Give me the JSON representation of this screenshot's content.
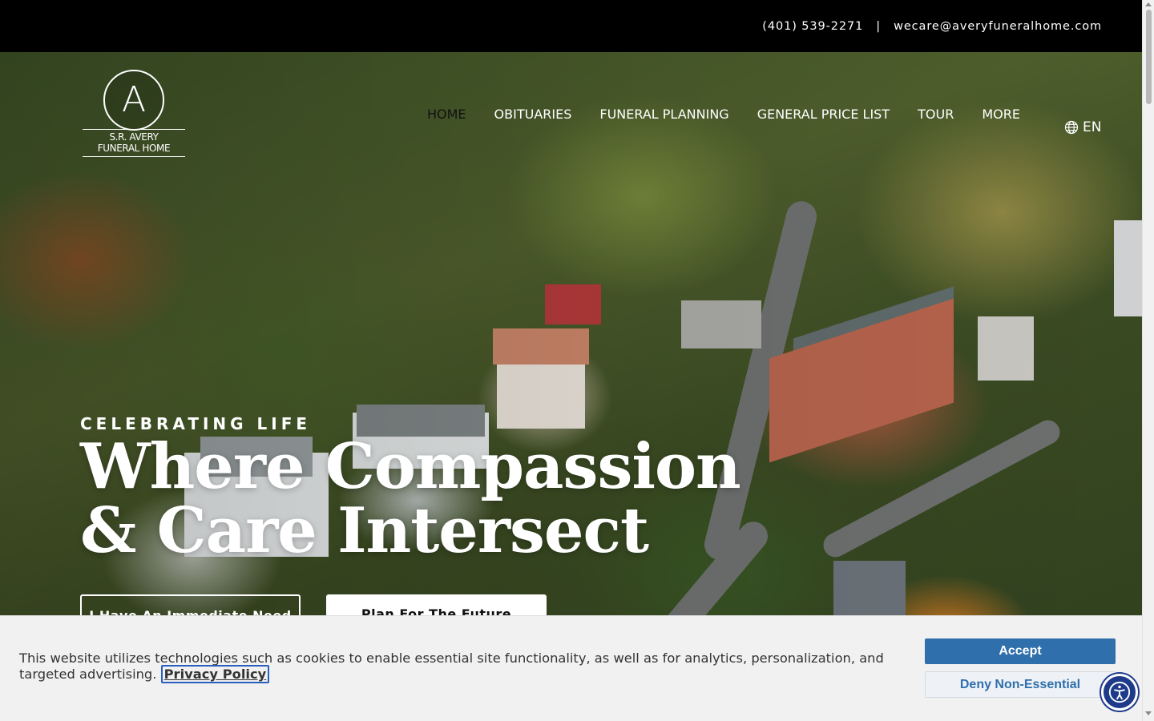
{
  "topbar": {
    "phone": "(401) 539-2271",
    "separator": "|",
    "email": "wecare@averyfuneralhome.com"
  },
  "logo": {
    "letter": "A",
    "line1": "S.R. AVERY",
    "line2": "FUNERAL HOME"
  },
  "nav": {
    "items": [
      {
        "label": "HOME",
        "active": true
      },
      {
        "label": "OBITUARIES"
      },
      {
        "label": "FUNERAL PLANNING"
      },
      {
        "label": "GENERAL PRICE LIST"
      },
      {
        "label": "TOUR"
      },
      {
        "label": "MORE"
      }
    ]
  },
  "lang": {
    "label": "EN",
    "icon": "globe-icon"
  },
  "hero": {
    "eyebrow": "CELEBRATING LIFE",
    "headline_line1": "Where Compassion",
    "headline_line2": "& Care Intersect",
    "cta_primary": "I Have An Immediate Need",
    "cta_secondary": "Plan For The Future"
  },
  "cookie": {
    "text": "This website utilizes technologies such as cookies to enable essential site functionality, as well as for analytics, personalization, and targeted advertising.",
    "privacy_link": "Privacy Policy",
    "accept": "Accept",
    "deny": "Deny Non-Essential"
  },
  "accessibility": {
    "icon": "accessibility-icon"
  },
  "colors": {
    "accent_blue": "#2f6fab",
    "topbar_bg": "#000000",
    "accessibility_bg": "#1e3a8a"
  }
}
